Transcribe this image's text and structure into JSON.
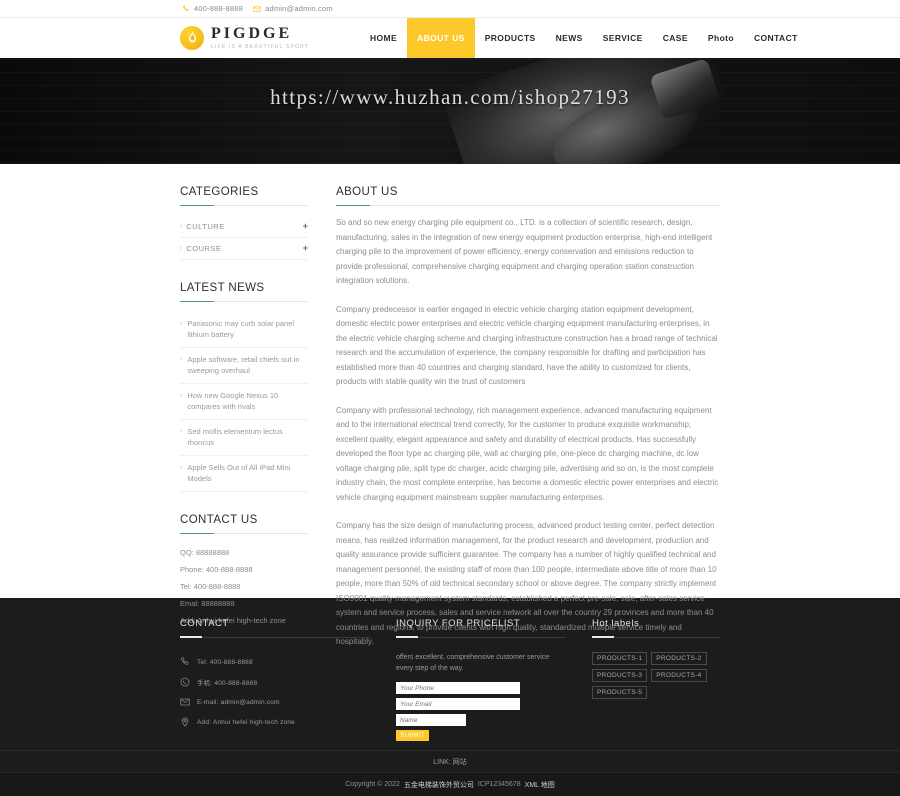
{
  "topbar": {
    "phone_icon": "phone-icon",
    "phone": "400-888-8888",
    "email_icon": "mail-icon",
    "email": "admin@admin.com"
  },
  "brand": {
    "name": "PIGDGE",
    "tagline": "LIFE IS A BEAUTIFUL SPORT",
    "logo_icon": "flame-logo-icon"
  },
  "nav": {
    "items": [
      {
        "label": "HOME",
        "active": false
      },
      {
        "label": "ABOUT US",
        "active": true
      },
      {
        "label": "PRODUCTS",
        "active": false
      },
      {
        "label": "NEWS",
        "active": false
      },
      {
        "label": "SERVICE",
        "active": false
      },
      {
        "label": "CASE",
        "active": false
      },
      {
        "label": "Photo",
        "active": false
      },
      {
        "label": "CONTACT",
        "active": false
      }
    ],
    "active_color": "#fdc82a"
  },
  "banner": {
    "watermark": "https://www.huzhan.com/ishop27193"
  },
  "sidebar": {
    "categories_title": "CATEGORIES",
    "categories": [
      {
        "label": "CULTURE",
        "expand": "+"
      },
      {
        "label": "COURSE",
        "expand": "+"
      }
    ],
    "news_title": "LATEST NEWS",
    "news": [
      "Panasonic may curb solar panel lithium battery",
      "Apple software, retail chiefs out in sweeping overhaul",
      "How new Google Nexus 10 compares with rivals",
      "Sed mollis elementum lectus rhoncus",
      "Apple Sells Out of All iPad Mini Models"
    ],
    "contact_title": "CONTACT US",
    "contact_lines": [
      "QQ: 88888888",
      "Phone: 400-888-8888",
      "Tel: 400-888-8888",
      "Emal: 88888888",
      "Add: Anhui hefei high-tech zone"
    ]
  },
  "content": {
    "title": "ABOUT US",
    "paragraphs": [
      "So and so new energy charging pile equipment co., LTD. is a collection of scientific research, design, manufacturing, sales in the integration of new energy equipment production enterprise, high-end intelligent charging pile to the improvement of power efficiency, energy conservation and emissions reduction to provide professional, comprehensive charging equipment and charging operation station construction integration solutions.",
      "Company predecessor is earlier engaged in electric vehicle charging station equipment development, domestic electric power enterprises and electric vehicle charging equipment manufacturing enterprises, in the electric vehicle charging scheme and charging infrastructure construction has a broad range of technical research and the accumulation of experience, the company responsible for drafting and participation has established more than 40 countries and charging standard, have the ability to customized for clients, products with stable quality win the trust of customers",
      "Company with professional technology, rich management experience, advanced manufacturing equipment and to the international electrical trend correctly, for the customer to produce exquisite workmanship, excellent quality, elegant appearance and safety and durability of electrical products. Has successfully developed the floor type ac charging pile, wall ac charging pile, one-piece dc charging machine, dc low voltage charging pile, split type dc charger, acidc charging pile, advertising and so on, is the most complete industry chain, the most complete enterprise, has become a domestic electric power enterprises and electric vehicle charging equipment mainstream supplier manufacturing enterprises.",
      "Company has the size design of manufacturing process, advanced product testing center, perfect detection means, has realized information management, for the product research and development, production and quality assurance provide sufficient guarantee. The company has a number of highly qualified technical and management personnel, the existing staff of more than 100 people, intermediate above title of more than 10 people, more than 50% of old technical secondary school or above degree. The company strictly implement ISO9001 quality management system standards, established a perfect pre-sale, sale, after-sales service system and service process, sales and service network all over the country 29 provinces and more than 40 countries and regions, to provide clients with high quality, standardized multiple service timely and hospitably."
    ]
  },
  "footer": {
    "contact": {
      "title": "CONTACT",
      "items": [
        {
          "icon": "phone-icon",
          "text": "Tel:  400-888-8888"
        },
        {
          "icon": "whatsapp-icon",
          "text": "手机:  400-888-8888"
        },
        {
          "icon": "mail-icon",
          "text": "E-mail: admin@admin.com"
        },
        {
          "icon": "location-pin-icon",
          "text": "Add:  Anhui hefei high-tech zone"
        }
      ]
    },
    "inquiry": {
      "title": "INQUIRY FOR PRICELIST",
      "description": "offers excellent, comprehensive customer service every step of the way.",
      "phone_placeholder": "Your Phone",
      "email_placeholder": "Your Email",
      "name_placeholder": "Name",
      "submit_label": "SUBMIT",
      "submit_color": "#fdc82a"
    },
    "labels": {
      "title": "Hot labels",
      "tags": [
        "PRODUCTS-1",
        "PRODUCTS-2",
        "PRODUCTS-3",
        "PRODUCTS-4",
        "PRODUCTS-5"
      ]
    },
    "linkbar": "LINK: 网站",
    "copyright_prefix": "Copyright © 2022",
    "copyright_company": "五金电梯装饰外贸公司",
    "copyright_icp": "ICP12345678",
    "copyright_xml": "XML 地图"
  }
}
